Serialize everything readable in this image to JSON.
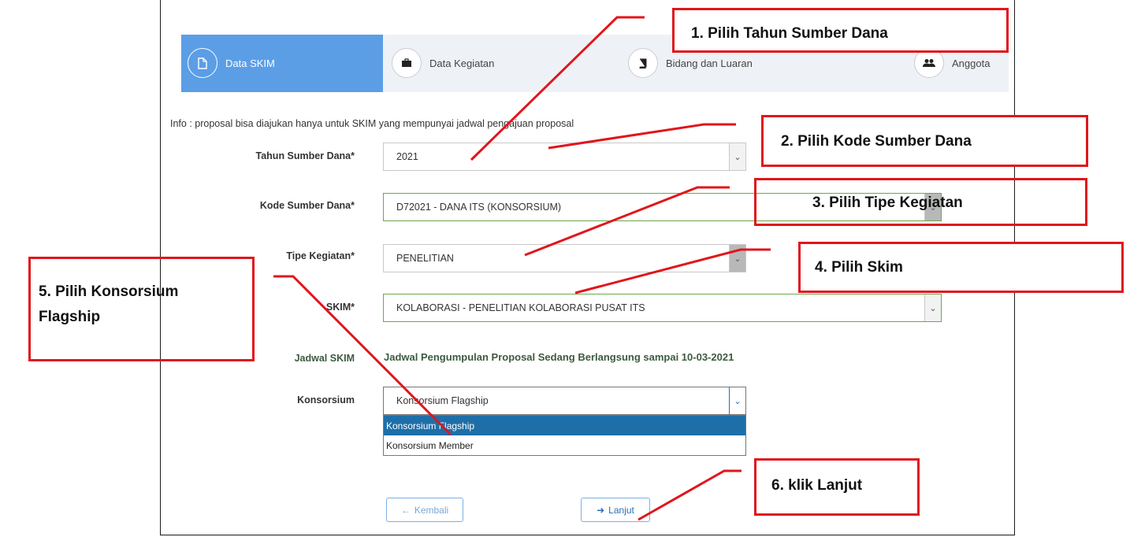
{
  "wizard": {
    "steps": [
      {
        "label": "Data SKIM",
        "icon": "document-icon"
      },
      {
        "label": "Data Kegiatan",
        "icon": "briefcase-icon"
      },
      {
        "label": "Bidang dan Luaran",
        "icon": "book-icon"
      },
      {
        "label": "Anggota",
        "icon": "users-icon"
      }
    ]
  },
  "info": "Info : proposal bisa diajukan hanya untuk SKIM yang mempunyai jadwal pengajuan proposal",
  "form": {
    "tahun": {
      "label": "Tahun Sumber Dana*",
      "value": "2021"
    },
    "kode": {
      "label": "Kode Sumber Dana*",
      "value": "D72021 - DANA ITS (KONSORSIUM)"
    },
    "tipe": {
      "label": "Tipe Kegiatan*",
      "value": "PENELITIAN"
    },
    "skim": {
      "label": "SKIM*",
      "value": "KOLABORASI - PENELITIAN KOLABORASI PUSAT ITS"
    },
    "jadwal": {
      "label": "Jadwal SKIM",
      "value": "Jadwal Pengumpulan Proposal Sedang Berlangsung sampai 10-03-2021"
    },
    "konsorsium": {
      "label": "Konsorsium",
      "value": "Konsorsium Flagship",
      "options": [
        "Konsorsium Flagship",
        "Konsorsium Member"
      ]
    }
  },
  "buttons": {
    "back": "Kembali",
    "next": "Lanjut"
  },
  "annotations": {
    "a1": "1.  Pilih Tahun Sumber Dana",
    "a2": "2. Pilih Kode Sumber Dana",
    "a3": "3.   Pilih Tipe Kegiatan",
    "a4": "4. Pilih Skim",
    "a5_line1": "5. Pilih Konsorsium",
    "a5_line2": "Flagship",
    "a6": "6. klik Lanjut"
  },
  "colors": {
    "accent": "#5b9ee6",
    "annotation": "#e0161c",
    "selected": "#1e6fa8"
  }
}
